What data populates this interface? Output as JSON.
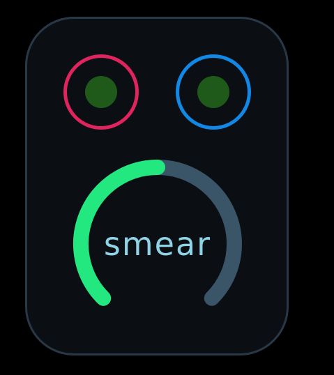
{
  "colors": {
    "background": "#000000",
    "panel_bg": "#0b0f14",
    "panel_border": "#293846",
    "led_left_ring": "#e0245e",
    "led_right_ring": "#1188e6",
    "led_fill": "#1f5a1a",
    "knob_value": "#22e87f",
    "knob_track": "#3a5468",
    "knob_label": "#8fd4e6"
  },
  "leds": [
    {
      "name": "left",
      "ring_color": "#e0245e",
      "lit": true
    },
    {
      "name": "right",
      "ring_color": "#1188e6",
      "lit": true
    }
  ],
  "knob": {
    "label": "smear",
    "value": 0.5,
    "track_icon": "arc-slider"
  }
}
